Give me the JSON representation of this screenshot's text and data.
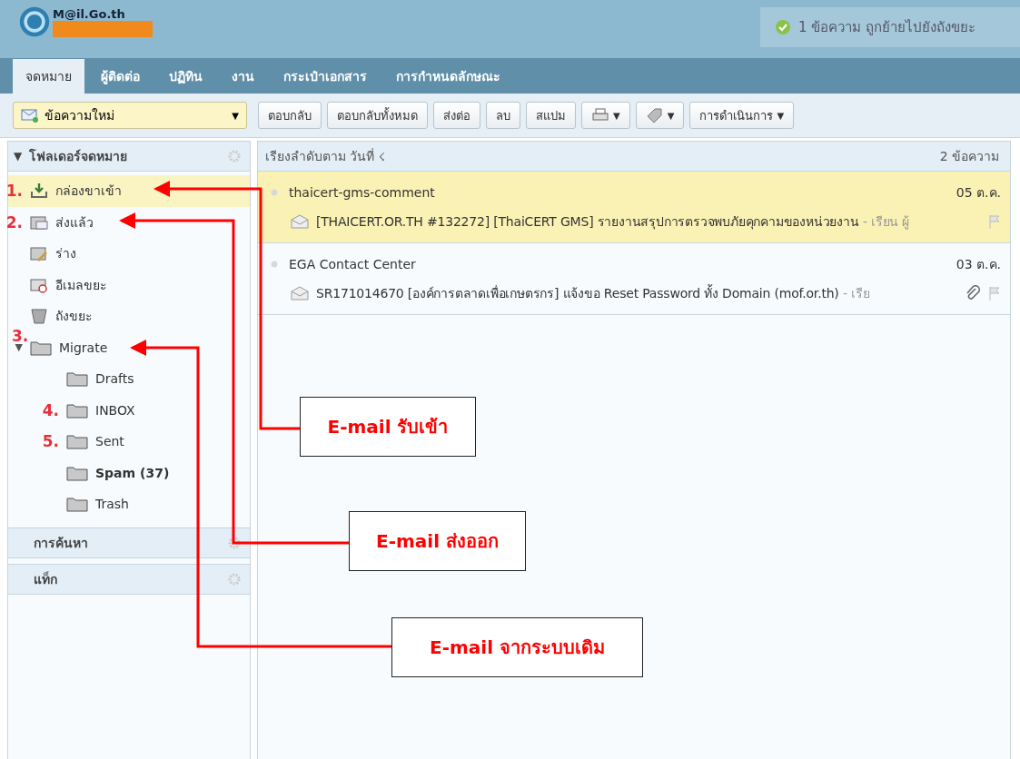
{
  "logo": {
    "text": "M@il.Go.th"
  },
  "notification": {
    "text": "1 ข้อความ ถูกย้ายไปยังถังขยะ"
  },
  "tabs": [
    {
      "label": "จดหมาย",
      "selected": true
    },
    {
      "label": "ผู้ติดต่อ",
      "selected": false
    },
    {
      "label": "ปฏิทิน",
      "selected": false
    },
    {
      "label": "งาน",
      "selected": false
    },
    {
      "label": "กระเป๋าเอกสาร",
      "selected": false
    },
    {
      "label": "การกำหนดลักษณะ",
      "selected": false
    }
  ],
  "new_message": {
    "label": "ข้อความใหม่",
    "caret": "▼"
  },
  "toolbar": [
    {
      "kind": "text",
      "label": "ตอบกลับ"
    },
    {
      "kind": "text",
      "label": "ตอบกลับทั้งหมด"
    },
    {
      "kind": "text",
      "label": "ส่งต่อ"
    },
    {
      "kind": "text",
      "label": "ลบ"
    },
    {
      "kind": "text",
      "label": "สแปม"
    },
    {
      "kind": "print",
      "caret": "▼"
    },
    {
      "kind": "tag",
      "caret": "▼"
    },
    {
      "kind": "text",
      "label": "การดำเนินการ",
      "caret": "▼"
    }
  ],
  "folders_panel": {
    "title": "โฟลเดอร์จดหมาย",
    "toggle": "▼",
    "folders": [
      {
        "name": "กล่องขาเข้า",
        "marker": "1.",
        "selected": true,
        "bold": false
      },
      {
        "name": "ส่งแล้ว",
        "marker": "2.",
        "selected": false,
        "bold": false
      },
      {
        "name": "ร่าง",
        "selected": false,
        "bold": false
      },
      {
        "name": "อีเมลขยะ",
        "selected": false,
        "bold": false
      },
      {
        "name": "ถังขยะ",
        "selected": false,
        "bold": false
      },
      {
        "name": "Migrate",
        "marker": "3.",
        "toggle": "▼",
        "expanded": true,
        "selected": false,
        "bold": false,
        "children": [
          {
            "name": "Drafts",
            "selected": false,
            "bold": false
          },
          {
            "name": "INBOX",
            "marker": "4.",
            "selected": false,
            "bold": false
          },
          {
            "name": "Sent",
            "marker": "5.",
            "selected": false,
            "bold": false
          },
          {
            "name": "Spam (37)",
            "selected": false,
            "bold": true
          },
          {
            "name": "Trash",
            "selected": false,
            "bold": false
          }
        ]
      }
    ]
  },
  "side_sections": [
    {
      "title": "การค้นหา"
    },
    {
      "title": "แท็ก"
    }
  ],
  "message_list": {
    "sort_label": "เรียงลำดับตาม วันที่",
    "sort_icon": "☇",
    "count": "2 ข้อความ",
    "messages": [
      {
        "sender": "thaicert-gms-comment",
        "date": "05 ต.ค.",
        "subject": "[THAICERT.OR.TH #132272] [ThaiCERT GMS] รายงานสรุปการตรวจพบภัยคุกคามของหน่วยงาน",
        "fragment": "- เรียน ผู้",
        "attachment": false,
        "selected": true
      },
      {
        "sender": "EGA Contact Center",
        "date": "03 ต.ค.",
        "subject": "SR171014670 [องค์การตลาดเพื่อเกษตรกร] แจ้งขอ Reset Password ทั้ง Domain (mof.or.th)",
        "fragment": "- เรีย",
        "attachment": true,
        "selected": false
      }
    ]
  },
  "callouts": [
    {
      "text": "E-mail รับเข้า"
    },
    {
      "text": "E-mail ส่งออก"
    },
    {
      "text": "E-mail จากระบบเดิม"
    }
  ]
}
